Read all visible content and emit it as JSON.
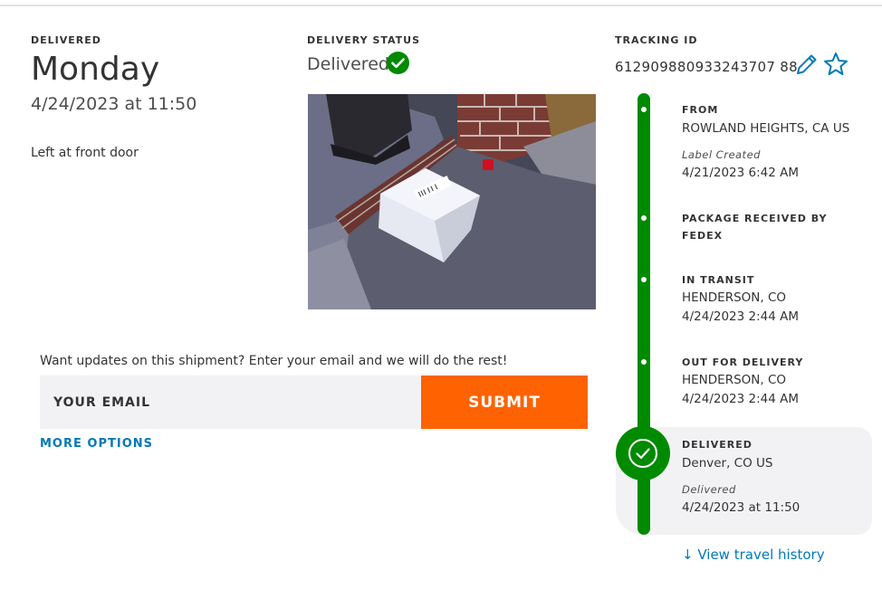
{
  "delivery": {
    "label": "DELIVERED",
    "day": "Monday",
    "datetime": "4/24/2023 at 11:50",
    "location_note": "Left at front door"
  },
  "status": {
    "label": "DELIVERY STATUS",
    "value": "Delivered",
    "icon": "check-circle-icon",
    "color": "#008a00"
  },
  "photo": {
    "icon": "package-photo"
  },
  "tracking": {
    "label": "TRACKING ID",
    "number": "612909880933243707 88",
    "edit_icon": "pencil-icon",
    "favorite_icon": "star-icon"
  },
  "updates": {
    "prompt": "Want updates on this shipment? Enter your email and we will do the rest!",
    "email_placeholder": "YOUR EMAIL",
    "submit_label": "SUBMIT",
    "more_options": "MORE OPTIONS",
    "accent": "#ff6200"
  },
  "timeline": {
    "events": [
      {
        "title": "FROM",
        "line1": "ROWLAND HEIGHTS, CA US",
        "note": "Label Created",
        "line2": "4/21/2023 6:42 AM"
      },
      {
        "title": "PACKAGE RECEIVED BY FEDEX"
      },
      {
        "title": "IN TRANSIT",
        "line1": "HENDERSON, CO",
        "line2": "4/24/2023 2:44 AM"
      },
      {
        "title": "OUT FOR DELIVERY",
        "line1": "HENDERSON, CO",
        "line2": "4/24/2023 2:44 AM"
      },
      {
        "title": "DELIVERED",
        "line1": "Denver, CO US",
        "note": "Delivered",
        "line2": "4/24/2023 at 11:50"
      }
    ],
    "view_history": "View travel history"
  }
}
